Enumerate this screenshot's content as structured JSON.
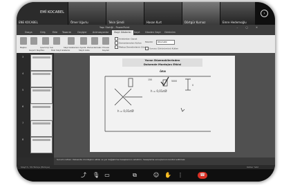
{
  "participants": [
    {
      "name": "EMİ KOCABEL",
      "caption": "ENE KOCABEL"
    },
    {
      "caption": "Ömer Uğurlu"
    },
    {
      "caption": "Tekin Şimdi"
    },
    {
      "caption": "Hasan Kurt"
    },
    {
      "caption": "Dörtgür Kurnaz"
    },
    {
      "caption": "Emre Hedemoğlu"
    }
  ],
  "app": {
    "title": "Yapı Statiği - PowerPoint",
    "tabs": [
      "Dosya",
      "Giriş",
      "Ekle",
      "Tasarım",
      "Geçişler",
      "Animasyonlar",
      "Slayt Gösterisi",
      "Kayıt",
      "Gözden Geçir",
      "Görünüm"
    ],
    "active_tab": "Slayt Gösterisi",
    "ribbon": {
      "buttons": [
        "Baştan",
        "Geçerli Slayttan",
        "Çevrimiçi Sun",
        "Özel Slayt Gösterisi",
        "Slayt Gösterisini Ayarla",
        "Slaytı Gizle",
        "Zamanlamaları Provası",
        "Kaydet"
      ],
      "options": [
        "Anlatımları Oynat",
        "Zamanlamaları Kullan",
        "Medya Denetimlerini Göster"
      ],
      "monitor_label": "Monitör",
      "monitor_value": "Otomatik",
      "presenter_view": "Sunucu Görünümünü Kullan"
    },
    "slide_numbers": [
      "3",
      "4",
      "5",
      "6",
      "7",
      "8"
    ],
    "slide": {
      "header_line1": "Yaran Düzenakilerinden",
      "header_line2": "Dalsende Montajını Etkisi",
      "title": "ÖRN",
      "ann_left": "h = 0,01ℓ/Ø",
      "ann_right": "h = 0,01ℓ/Ø",
      "ann_top": "150",
      "ann_top2": "5000",
      "ann_side": "0"
    },
    "notes": "Sunum notları: Dalsende montajının etkisi ve yer değiştirme hesaplarının anlatımı; hesaplama sonuçlarının kontrol edilmesi.",
    "status_left": "Slayt 5 / 39   Türkçe (Türkiye)",
    "status_right": "Notlar   %62"
  },
  "controls": {
    "icons": [
      "arrow-icon",
      "mic-off-icon",
      "video-off-icon",
      "share-screen-icon",
      "emoji-icon",
      "hand-icon",
      "more-icon",
      "end-call-icon"
    ]
  }
}
